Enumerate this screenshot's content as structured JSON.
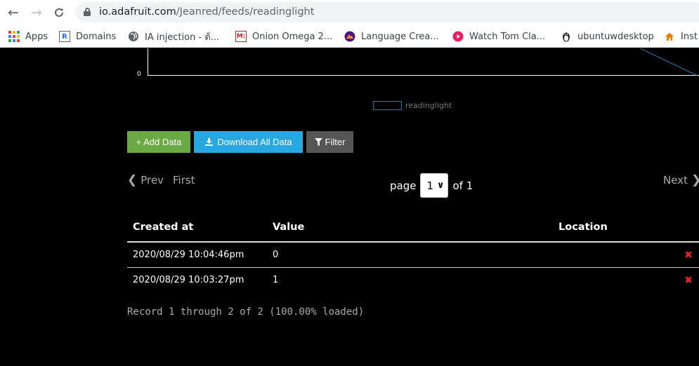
{
  "browser": {
    "url_host": "io.adafruit.com",
    "url_path": "/Jeanred/feeds/readinglight",
    "bookmarks": [
      {
        "label": "Apps",
        "icon": "apps-grid-icon"
      },
      {
        "label": "Domains",
        "icon": "r-square-icon"
      },
      {
        "label": "IA injection - ต้...",
        "icon": "globe-icon"
      },
      {
        "label": "Onion Omega 2...",
        "icon": "m-badge-icon"
      },
      {
        "label": "Language Crea...",
        "icon": "mountain-circle-icon"
      },
      {
        "label": "Watch Tom Cla...",
        "icon": "play-circle-icon"
      },
      {
        "label": "ubuntuwdesktop",
        "icon": "penguin-icon"
      },
      {
        "label": "Inst",
        "icon": "home-icon"
      }
    ]
  },
  "chart": {
    "y_tick_zero": "0",
    "legend_label": "readinglight",
    "series_color": "#1f77b4"
  },
  "chart_data": {
    "type": "line",
    "series": [
      {
        "name": "readinglight",
        "values": [
          1,
          0
        ]
      }
    ],
    "y_ticks": [
      "0"
    ],
    "legend": [
      "readinglight"
    ]
  },
  "actions": {
    "add_label": "+ Add Data",
    "download_label": "Download All Data",
    "filter_label": "Filter",
    "add_color": "#6aaa44",
    "download_color": "#27a8e0",
    "filter_color": "#555555"
  },
  "pager": {
    "prev": "Prev",
    "first": "First",
    "page_word": "page",
    "current_page": "1",
    "of_text": "of 1",
    "next": "Next"
  },
  "table": {
    "headers": [
      "Created at",
      "Value",
      "Location"
    ],
    "rows": [
      {
        "created_at": "2020/08/29 10:04:46pm",
        "value": "0",
        "location": ""
      },
      {
        "created_at": "2020/08/29 10:03:27pm",
        "value": "1",
        "location": ""
      }
    ]
  },
  "status": {
    "records_text": "Record 1 through 2 of 2 (100.00% loaded)"
  }
}
